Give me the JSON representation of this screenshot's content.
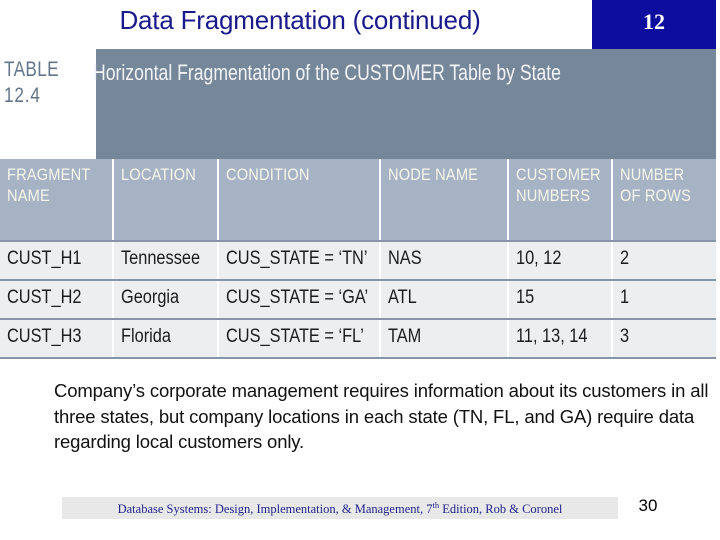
{
  "slide": {
    "title": "Data Fragmentation (continued)",
    "chapter_badge": "12",
    "slide_number": "30",
    "accent_blue": "#0d0d9e",
    "title_color": "#1a1a8c",
    "banner_color": "#77879a",
    "header_row_color": "#a5b3c4",
    "data_row_color": "#eceef0"
  },
  "figure": {
    "table_label": "TABLE",
    "table_number": "12.4",
    "caption": "Horizontal Fragmentation of the CUSTOMER Table by State",
    "columns": [
      "FRAGMENT NAME",
      "LOCATION",
      "CONDITION",
      "NODE NAME",
      "CUSTOMER NUMBERS",
      "NUMBER OF ROWS"
    ],
    "columns_lines": [
      [
        "FRAGMENT",
        "NAME"
      ],
      [
        "LOCATION"
      ],
      [
        "CONDITION"
      ],
      [
        "NODE NAME"
      ],
      [
        "CUSTOMER",
        "NUMBERS"
      ],
      [
        "NUMBER",
        "OF ROWS"
      ]
    ],
    "rows": [
      {
        "fragment_name": "CUST_H1",
        "location": "Tennessee",
        "condition": "CUS_STATE = ‘TN’",
        "node_name": "NAS",
        "customer_numbers": "10, 12",
        "number_of_rows": "2"
      },
      {
        "fragment_name": "CUST_H2",
        "location": "Georgia",
        "condition": "CUS_STATE = ‘GA’",
        "node_name": "ATL",
        "customer_numbers": "15",
        "number_of_rows": "1"
      },
      {
        "fragment_name": "CUST_H3",
        "location": "Florida",
        "condition": "CUS_STATE = ‘FL’",
        "node_name": "TAM",
        "customer_numbers": "11, 13, 14",
        "number_of_rows": "3"
      }
    ]
  },
  "body": {
    "paragraph": "Company’s corporate management requires information about its customers in all three states, but company locations in each state (TN, FL, and GA) require data regarding local customers only."
  },
  "footer": {
    "text_before": "Database Systems: Design, Implementation, & Management, 7",
    "superscript": "th",
    "text_after": " Edition, Rob & Coronel"
  }
}
